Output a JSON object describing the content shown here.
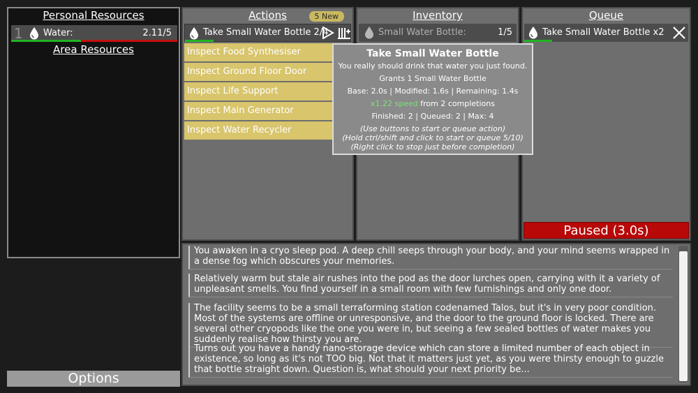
{
  "personal": {
    "title": "Personal Resources",
    "resource": {
      "index": "1",
      "name": "Water:",
      "value": "2.11/5",
      "fill_fraction": 0.422,
      "icon": "water-drop-icon"
    },
    "area_title": "Area Resources"
  },
  "options_label": "Options",
  "actions": {
    "title": "Actions",
    "badge": "5 New",
    "main": {
      "label": "Take Small Water Bottle 2/4",
      "progress_fraction": 0.17,
      "icon": "water-drop-icon"
    },
    "items": [
      {
        "label": "Inspect Food Synthesiser"
      },
      {
        "label": "Inspect Ground Floor Door"
      },
      {
        "label": "Inspect Life Support"
      },
      {
        "label": "Inspect Main Generator"
      },
      {
        "label": "Inspect Water Recycler"
      }
    ]
  },
  "inventory": {
    "title": "Inventory",
    "item": {
      "label": "Small Water Bottle:",
      "value": "1/5"
    }
  },
  "queue": {
    "title": "Queue",
    "item": {
      "label": "Take Small Water Bottle x2",
      "progress_fraction": 0.17
    },
    "status": "Paused (3.0s)"
  },
  "tooltip": {
    "title": "Take Small Water Bottle",
    "desc": "You really should drink that water you just found.",
    "grants": "Grants 1 Small Water Bottle",
    "timing": "Base: 2.0s | Modified: 1.6s | Remaining: 1.4s",
    "speed": "x1.22 speed",
    "speed_suffix": " from 2 completions",
    "counts": "Finished: 2 | Queued: 2 | Max: 4",
    "help1": "(Use buttons to start or queue action)",
    "help2": "(Hold ctrl/shift and click to start or queue 5/10)",
    "help3": "(Right click to stop just before completion)"
  },
  "log": [
    "You awaken in a cryo sleep pod. A deep chill seeps through your body, and your mind seems wrapped in a dense fog which obscures your memories.",
    "Relatively warm but stale air rushes into the pod as the door lurches open, carrying with it a variety of unpleasant smells. You find yourself in a small room with few furnishings and only one door.",
    "The facility seems to be a small terraforming station codenamed Talos, but it's in very poor condition. Most of the systems are offline or unresponsive, and the door to the ground floor is locked. There are several other cryopods like the one you were in, but seeing a few sealed bottles of water makes you suddenly realise how thirsty you are.",
    "Turns out you have a handy nano-storage device which can store a limited number of each object in existence, so long as it's not TOO big. Not that it matters just yet, as you were thirsty enough to guzzle that bottle straight down. Question is, what should your next priority be..."
  ],
  "colors": {
    "progress": "#22b422",
    "empty_bar": "#c41010",
    "action_item": "#d8c56c",
    "paused": "#b80808"
  }
}
